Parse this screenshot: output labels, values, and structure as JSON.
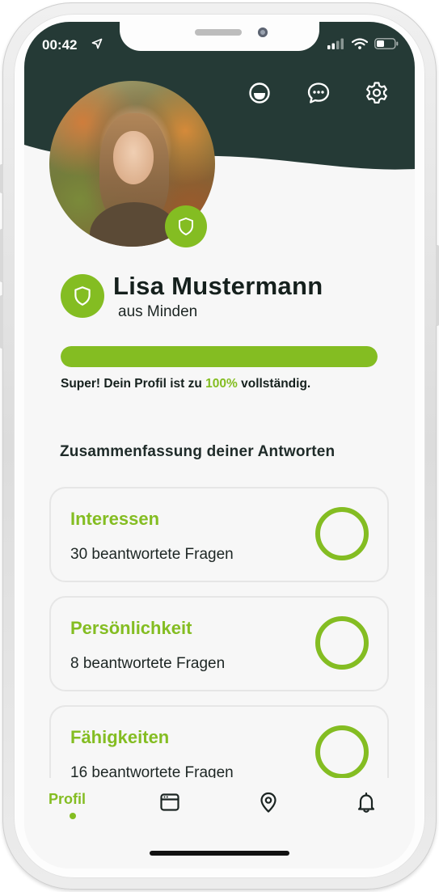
{
  "status_bar": {
    "time": "00:42",
    "icons": [
      "location-arrow-icon",
      "signal-icon",
      "wifi-icon",
      "battery-icon"
    ]
  },
  "header": {
    "background_color": "#253a36",
    "actions": [
      {
        "icon": "smiley-face-icon"
      },
      {
        "icon": "chat-bubble-icon"
      },
      {
        "icon": "gear-icon"
      }
    ]
  },
  "profile": {
    "name": "Lisa Mustermann",
    "location": "aus Minden",
    "verified_icon": "shield-icon",
    "completion_percent": 100,
    "completion_prefix": "Super! Dein Profil ist zu ",
    "completion_value": "100%",
    "completion_suffix": " vollständig."
  },
  "summary": {
    "title": "Zusammenfassung deiner Antworten",
    "cards": [
      {
        "title": "Interessen",
        "subtitle": "30 beantwortete Fragen"
      },
      {
        "title": "Persönlichkeit",
        "subtitle": "8 beantwortete Fragen"
      },
      {
        "title": "Fähigkeiten",
        "subtitle": "16 beantwortete Fragen"
      }
    ]
  },
  "bottom_nav": {
    "active_label": "Profil",
    "items": [
      {
        "label": "Profil",
        "icon": "profile-icon",
        "active": true
      },
      {
        "icon": "browser-window-icon"
      },
      {
        "icon": "map-pin-icon"
      },
      {
        "icon": "bell-icon"
      }
    ]
  },
  "colors": {
    "accent": "#84bd22",
    "dark": "#253a36",
    "text": "#15201d"
  }
}
